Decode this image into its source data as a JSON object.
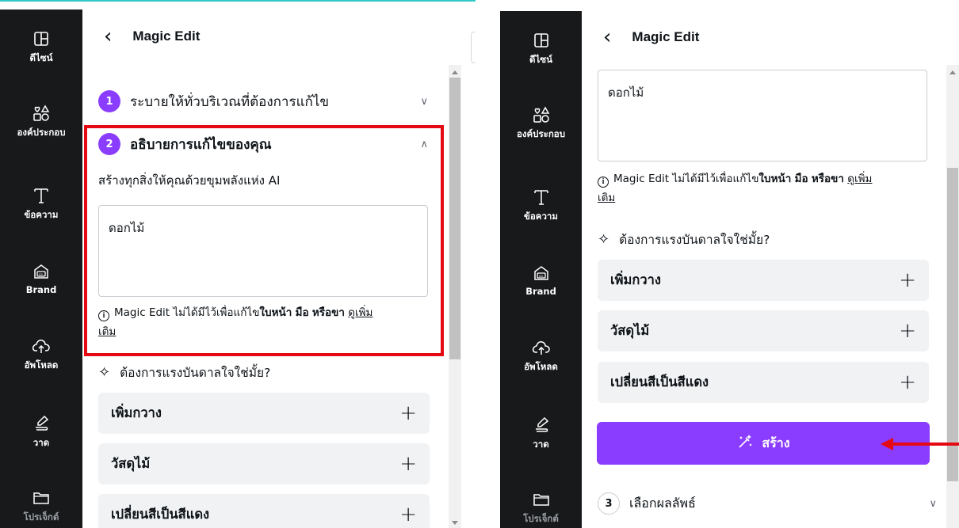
{
  "sidebar": {
    "items": [
      {
        "label": "ดีไซน์",
        "icon": "layout-icon"
      },
      {
        "label": "องค์ประกอบ",
        "icon": "elements-icon"
      },
      {
        "label": "ข้อความ",
        "icon": "text-icon"
      },
      {
        "label": "Brand",
        "icon": "brand-icon"
      },
      {
        "label": "อัพโหลด",
        "icon": "upload-icon"
      },
      {
        "label": "วาด",
        "icon": "draw-icon"
      },
      {
        "label": "โปรเจ็กต์",
        "icon": "folder-icon"
      }
    ]
  },
  "header": {
    "title": "Magic Edit",
    "back_icon": "chevron-left-icon"
  },
  "steps": {
    "step1": {
      "number": "1",
      "label": "ระบายให้ทั่วบริเวณที่ต้องการแก้ไข"
    },
    "step2": {
      "number": "2",
      "label": "อธิบายการแก้ไขของคุณ"
    },
    "step3": {
      "number": "3",
      "label": "เลือกผลลัพธ์"
    }
  },
  "description": "สร้างทุกสิ่งให้คุณด้วยขุมพลังแห่ง AI",
  "prompt_input": {
    "value": "ดอกไม้"
  },
  "note": {
    "prefix": "Magic Edit ไม่ได้มีไว้เพื่อแก้ไข",
    "face": "ใบหน้า",
    "hands": "มือ",
    "or": "หรือ",
    "legs": "ขา",
    "more_line1": "ดูเพิ่ม",
    "more_line2": "เติม"
  },
  "inspiration": {
    "label": "ต้องการแรงบันดาลใจใช่มั้ย?",
    "suggestions": [
      "เพิ่มกวาง",
      "วัสดุไม้",
      "เปลี่ยนสีเป็นสีแดง"
    ]
  },
  "create_button": {
    "label": "สร้าง"
  },
  "colors": {
    "accent": "#8b3dff",
    "highlight": "#e50914",
    "sidebar": "#18191b",
    "suggestion_bg": "#f1f2f4"
  }
}
